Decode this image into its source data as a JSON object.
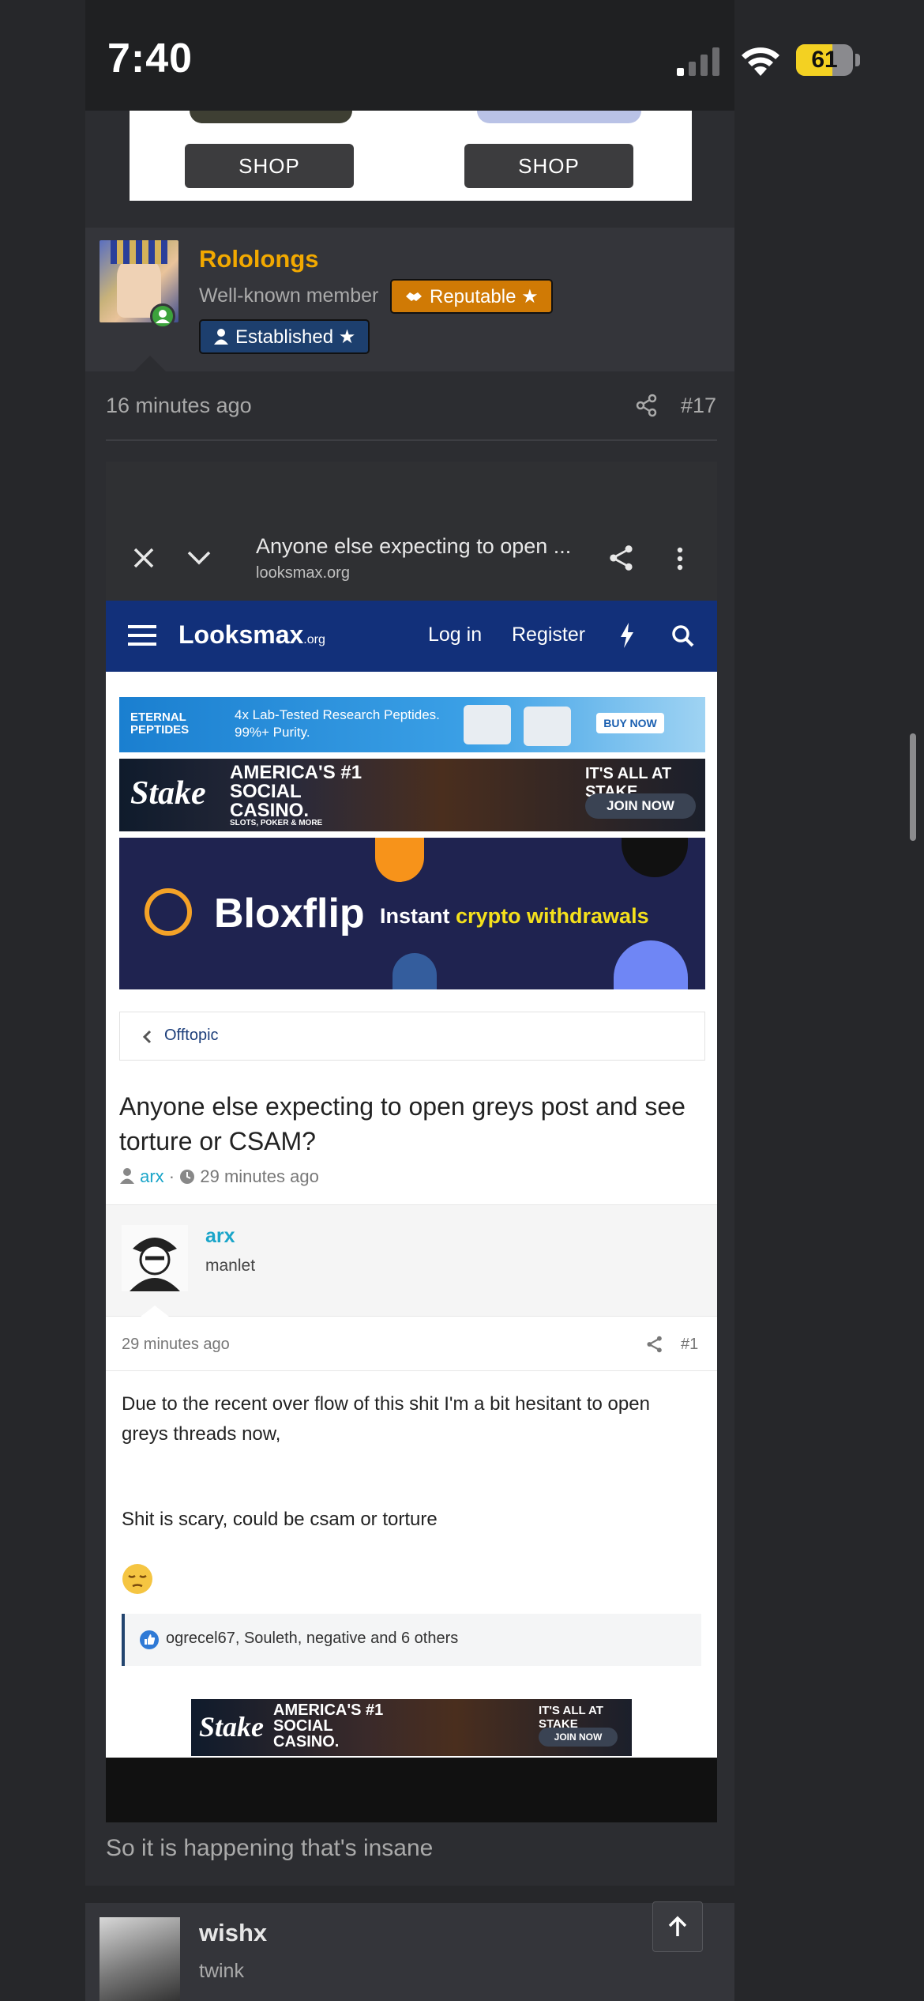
{
  "status_bar": {
    "time": "7:40",
    "battery": "61"
  },
  "top_ad": {
    "left_button": "SHOP",
    "right_button": "SHOP"
  },
  "post": {
    "username": "Rololongs",
    "user_title": "Well-known member",
    "badge_reputable": "Reputable ★",
    "badge_established": "Established ★",
    "time_ago": "16 minutes ago",
    "post_number": "#17",
    "caption": "So it is happening that's insane"
  },
  "embedded": {
    "browser_title": "Anyone else expecting to open ...",
    "browser_url": "looksmax.org",
    "site_logo": "Looksmax",
    "site_logo_suffix": ".org",
    "nav_login": "Log in",
    "nav_register": "Register",
    "ad1_brand": "ETERNAL PEPTIDES",
    "ad1_text": "4x Lab-Tested Research Peptides. 99%+ Purity.",
    "ad1_button": "BUY NOW",
    "ad2_brand": "Stake",
    "ad2_text": "AMERICA'S #1 SOCIAL CASINO.",
    "ad2_subtext": "SLOTS, POKER & MORE",
    "ad2_tagline": "IT'S ALL AT STAKE",
    "ad2_button": "JOIN NOW",
    "ad3_brand": "Bloxflip",
    "ad3_text_white": "Instant",
    "ad3_text_yellow": "crypto withdrawals",
    "breadcrumb": "Offtopic",
    "thread_title": "Anyone else expecting to open greys post and see torture or CSAM?",
    "thread_author": "arx",
    "thread_time": "29 minutes ago",
    "op_username": "arx",
    "op_title": "manlet",
    "op_time": "29 minutes ago",
    "op_number": "#1",
    "op_line1": "Due to the recent over flow of this shit I'm a bit hesitant to open greys threads now,",
    "op_line2": "Shit is scary, could be csam or torture",
    "reactions": "ogrecel67, Souleth, negative and 6 others",
    "ad4_brand": "Stake",
    "ad4_text": "AMERICA'S #1 SOCIAL CASINO.",
    "ad4_tagline": "IT'S ALL AT STAKE",
    "ad4_button": "JOIN NOW"
  },
  "next_post": {
    "username": "wishx",
    "user_title": "twink"
  }
}
